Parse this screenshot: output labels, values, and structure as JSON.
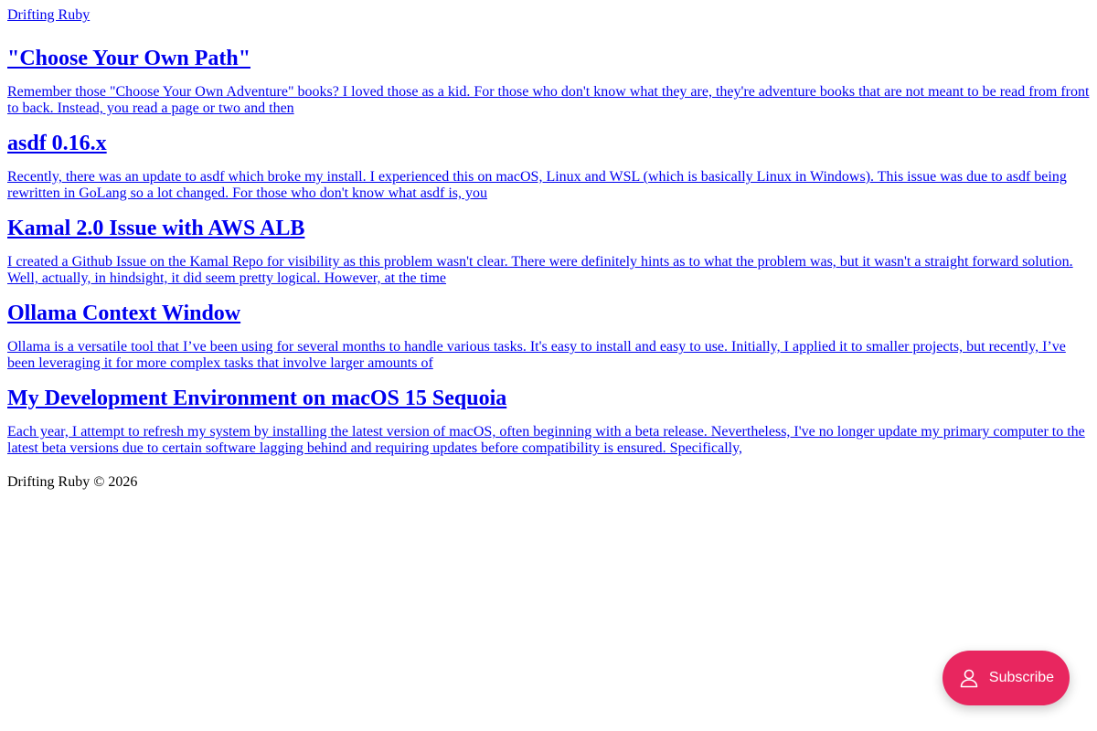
{
  "site": {
    "name": "Drifting Ruby"
  },
  "posts": [
    {
      "title": "\"Choose Your Own Path\"",
      "excerpt": "Remember those \"Choose Your Own Adventure\" books? I loved those as a kid. For those who don't know what they are, they're adventure books that are not meant to be read from front to back. Instead, you read a page or two and then"
    },
    {
      "title": "asdf 0.16.x",
      "excerpt": "Recently, there was an update to asdf which broke my install. I experienced this on macOS, Linux and WSL (which is basically Linux in Windows). This issue was due to asdf being rewritten in GoLang so a lot changed. For those who don't know what asdf is, you"
    },
    {
      "title": "Kamal 2.0 Issue with AWS ALB",
      "excerpt": "I created a Github Issue on the Kamal Repo for visibility as this problem wasn't clear. There were definitely hints as to what the problem was, but it wasn't a straight forward solution. Well, actually, in hindsight, it did seem pretty logical. However, at the time"
    },
    {
      "title": "Ollama Context Window",
      "excerpt": "Ollama is a versatile tool that I’ve been using for several months to handle various tasks. It's easy to install and easy to use. Initially, I applied it to smaller projects, but recently, I’ve been leveraging it for more complex tasks that involve larger amounts of"
    },
    {
      "title": "My Development Environment on macOS 15 Sequoia",
      "excerpt": "Each year, I attempt to refresh my system by installing the latest version of macOS, often beginning with a beta release. Nevertheless, I've no longer update my primary computer to the latest beta versions due to certain software lagging behind and requiring updates before compatibility is ensured. Specifically,"
    }
  ],
  "footer": {
    "text": "Drifting Ruby © 2026"
  },
  "subscribe": {
    "label": "Subscribe",
    "icon": "user-icon",
    "background_color": "#e8265f",
    "text_color": "#ffffff"
  },
  "colors": {
    "link": "#0000EE",
    "text": "#000000",
    "background": "#ffffff"
  }
}
